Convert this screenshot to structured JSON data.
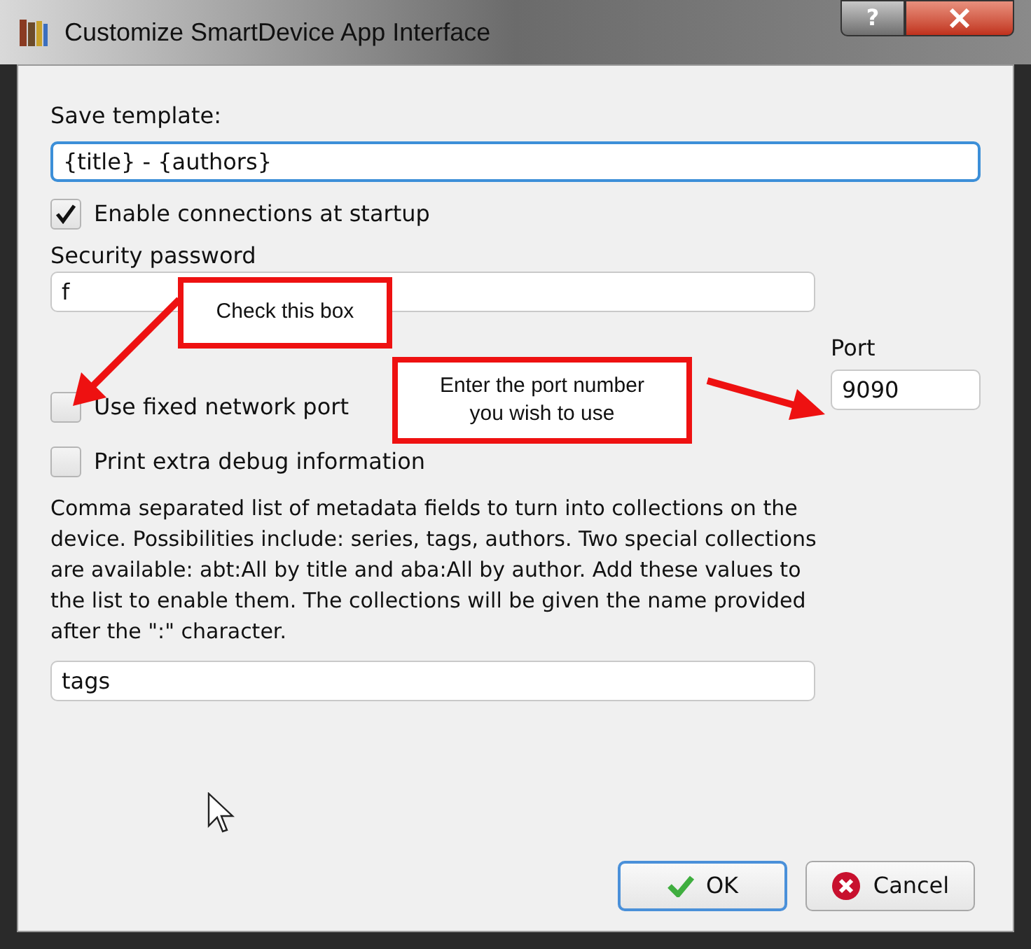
{
  "window": {
    "title": "Customize SmartDevice App Interface",
    "help_button": "?"
  },
  "template": {
    "label": "Save template:",
    "value": "{title} - {authors}"
  },
  "enable_connections": {
    "label": "Enable connections at startup",
    "checked": true
  },
  "password": {
    "label": "Security password",
    "value": "f"
  },
  "port": {
    "label": "Port",
    "value": "9090"
  },
  "options": [
    {
      "label": "Use fixed network port",
      "checked": false
    },
    {
      "label": "Print extra debug information",
      "checked": false
    }
  ],
  "collections": {
    "description": "Comma separated list of metadata fields to turn into collections on the device. Possibilities include: series, tags, authors. Two special collections are available: abt:All by title and aba:All by author. Add  these values to the list to enable them. The collections will be given the name provided after the \":\" character.",
    "value": "tags"
  },
  "buttons": [
    {
      "kind": "ok",
      "label": "OK",
      "selected": true
    },
    {
      "kind": "cancel",
      "label": "Cancel",
      "selected": false
    }
  ],
  "annotations": [
    {
      "kind": "left",
      "text": "Check this box"
    },
    {
      "kind": "right",
      "text": "Enter the port number you wish to use"
    }
  ]
}
